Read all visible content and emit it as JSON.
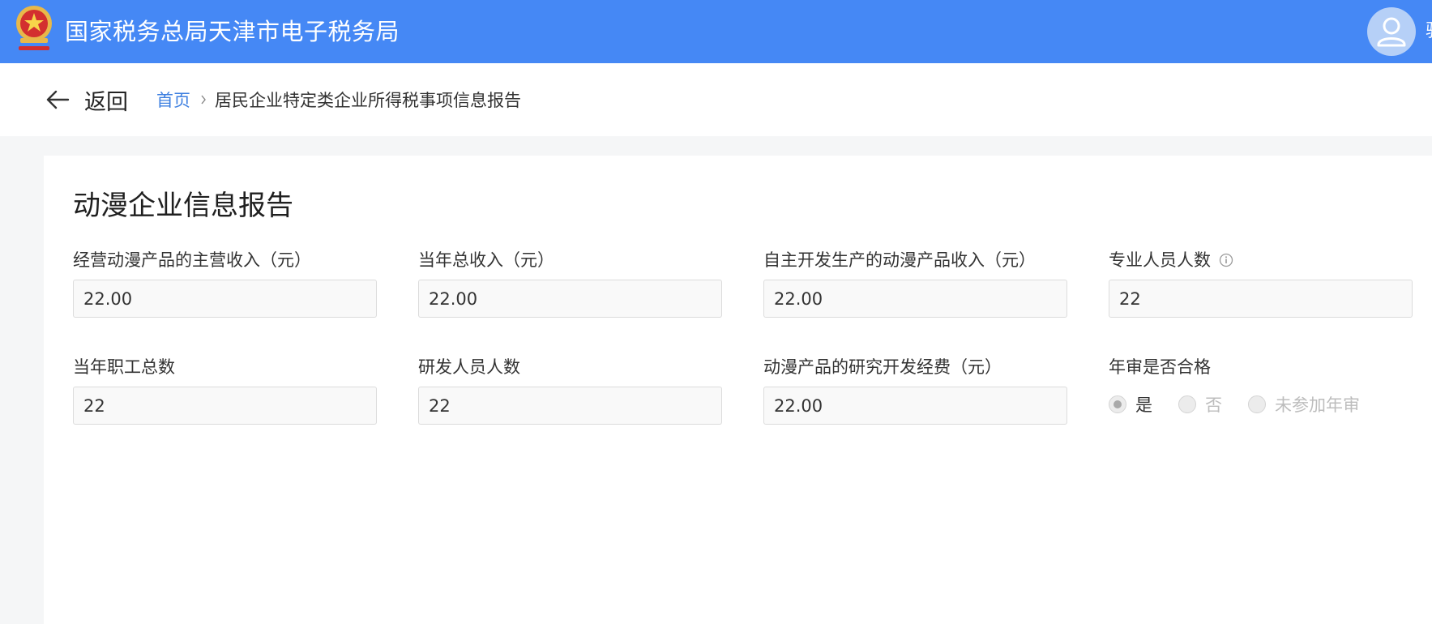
{
  "header": {
    "site_title": "国家税务总局天津市电子税务局",
    "user_name_partial": "骈",
    "brand_color": "#4588f5"
  },
  "nav": {
    "back_label": "返回",
    "breadcrumb_home": "首页",
    "breadcrumb_current": "居民企业特定类企业所得税事项信息报告",
    "link_color": "#3d7fe0"
  },
  "form": {
    "section_title": "动漫企业信息报告",
    "fields": [
      {
        "label": "经营动漫产品的主营收入（元）",
        "value": "22.00"
      },
      {
        "label": "当年总收入（元）",
        "value": "22.00"
      },
      {
        "label": "自主开发生产的动漫产品收入（元）",
        "value": "22.00"
      },
      {
        "label": "专业人员人数",
        "value": "22"
      },
      {
        "label": "当年职工总数",
        "value": "22"
      },
      {
        "label": "研发人员人数",
        "value": "22"
      },
      {
        "label": "动漫产品的研究开发经费（元）",
        "value": "22.00"
      }
    ],
    "annual_review": {
      "label": "年审是否合格",
      "options": [
        "是",
        "否",
        "未参加年审"
      ],
      "selected": "是"
    }
  }
}
